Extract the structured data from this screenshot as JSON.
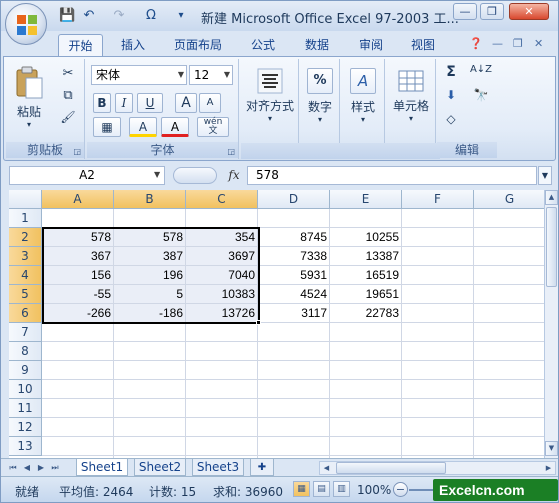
{
  "window": {
    "title": "新建 Microsoft Office Excel 97-2003 工..."
  },
  "quick_access": {
    "items": [
      {
        "icon": "save-icon",
        "glyph": "💾"
      },
      {
        "icon": "undo-icon",
        "glyph": "↶"
      },
      {
        "icon": "redo-icon",
        "glyph": "↷"
      },
      {
        "icon": "omega-icon",
        "glyph": "Ω"
      },
      {
        "icon": "customize-dropdown-icon",
        "glyph": "▾"
      }
    ]
  },
  "ribbon_tabs": [
    {
      "label": "开始",
      "active": true
    },
    {
      "label": "插入"
    },
    {
      "label": "页面布局"
    },
    {
      "label": "公式"
    },
    {
      "label": "数据"
    },
    {
      "label": "审阅"
    },
    {
      "label": "视图"
    }
  ],
  "ribbon": {
    "clipboard": {
      "label": "剪贴板",
      "paste_label": "粘贴",
      "cut_glyph": "✂",
      "copy_glyph": "⧉",
      "format_painter_glyph": "🖌"
    },
    "font": {
      "label": "字体",
      "font_name": "宋体",
      "font_size": "12",
      "bold": "B",
      "italic": "I",
      "underline": "U",
      "grow": "A",
      "shrink": "A",
      "border": "▦",
      "fill": "A",
      "color": "A",
      "phonetic": "wén\n文"
    },
    "alignment": {
      "label": "对齐方式"
    },
    "number": {
      "label": "数字",
      "symbol": "%"
    },
    "styles": {
      "label": "样式",
      "symbol": "A"
    },
    "cells": {
      "label": "单元格"
    },
    "editing": {
      "label": "编辑",
      "sum": "Σ",
      "sort": "A↓Z",
      "fill_glyph": "⬇",
      "find_glyph": "🔭",
      "clear_glyph": "◇"
    }
  },
  "formula_bar": {
    "name_box": "A2",
    "fx": "fx",
    "formula": "578"
  },
  "grid": {
    "columns": [
      "A",
      "B",
      "C",
      "D",
      "E",
      "F",
      "G"
    ],
    "selected_columns": [
      "A",
      "B",
      "C"
    ],
    "rows": [
      "1",
      "2",
      "3",
      "4",
      "5",
      "6",
      "7",
      "8",
      "9",
      "10",
      "11",
      "12",
      "13"
    ],
    "selected_rows": [
      "2",
      "3",
      "4",
      "5",
      "6"
    ],
    "cells": [
      [
        "",
        "",
        "",
        "",
        ""
      ],
      [
        "578",
        "578",
        "354",
        "8745",
        "10255"
      ],
      [
        "367",
        "387",
        "3697",
        "7338",
        "13387"
      ],
      [
        "156",
        "196",
        "7040",
        "5931",
        "16519"
      ],
      [
        "-55",
        "5",
        "10383",
        "4524",
        "19651"
      ],
      [
        "-266",
        "-186",
        "13726",
        "3117",
        "22783"
      ]
    ],
    "selection": "A2:C6"
  },
  "sheet_tabs": [
    {
      "label": "Sheet1",
      "active": true
    },
    {
      "label": "Sheet2"
    },
    {
      "label": "Sheet3"
    }
  ],
  "status_bar": {
    "ready": "就绪",
    "average": "平均值: 2464",
    "count": "计数: 15",
    "sum": "求和: 36960",
    "zoom": "100%",
    "watermark": "Excelcn.com"
  }
}
